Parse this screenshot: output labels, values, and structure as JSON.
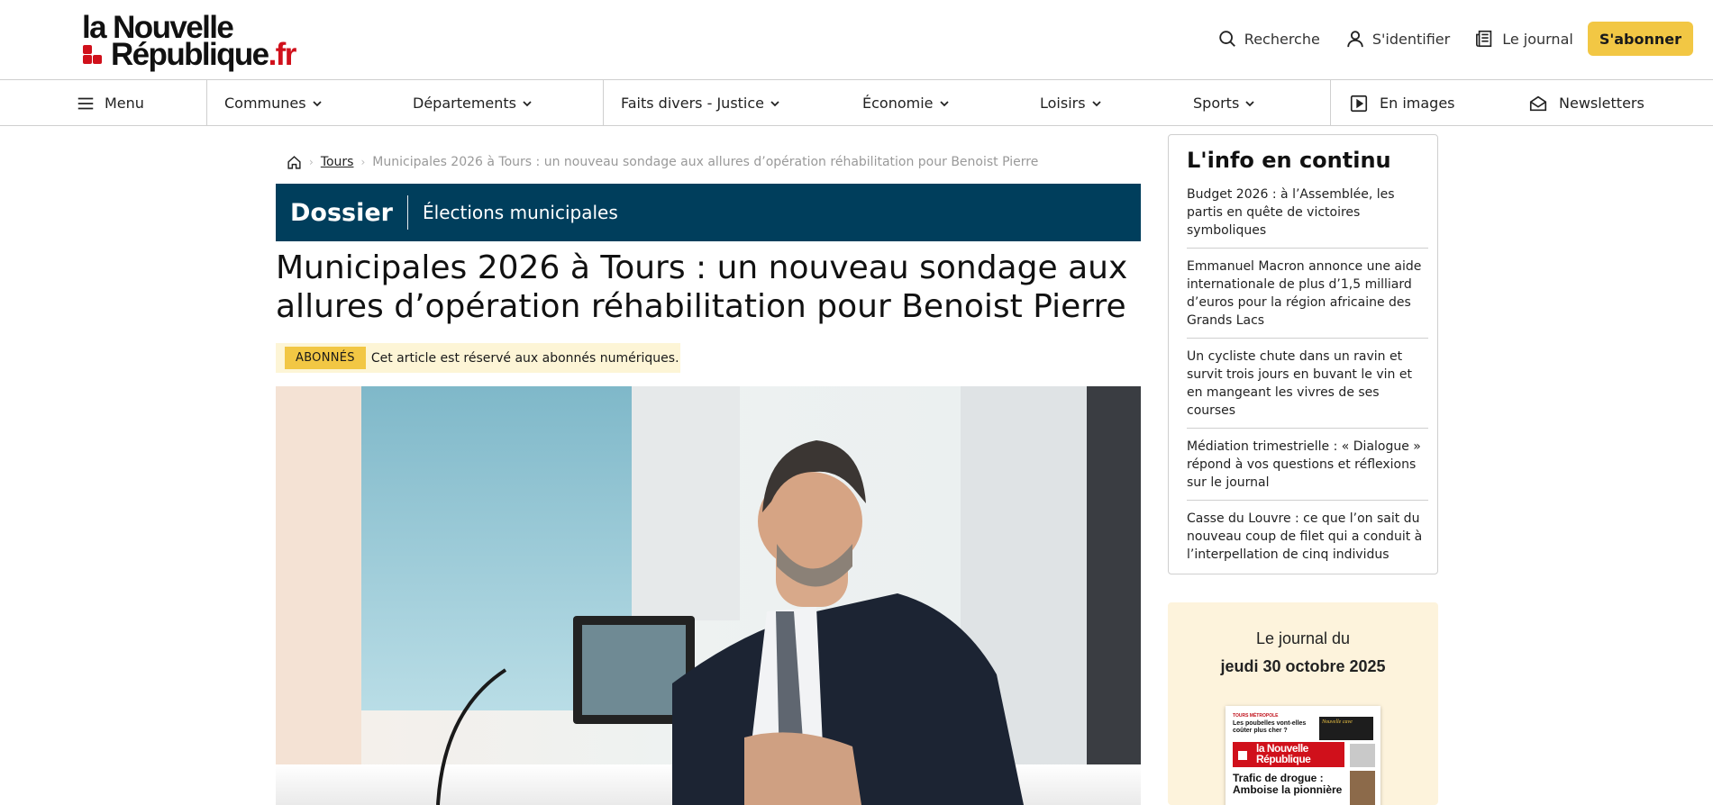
{
  "header": {
    "logo_line1": "la Nouvelle",
    "logo_line2": "République",
    "logo_tld": ".fr",
    "search_label": "Recherche",
    "login_label": "S'identifier",
    "journal_label": "Le journal",
    "subscribe_label": "S'abonner",
    "brand_red": "#d0101b",
    "accent_yellow": "#f2c744"
  },
  "nav": {
    "menu_label": "Menu",
    "items": [
      {
        "label": "Communes"
      },
      {
        "label": "Départements"
      },
      {
        "label": "Faits divers - Justice"
      },
      {
        "label": "Économie"
      },
      {
        "label": "Loisirs"
      },
      {
        "label": "Sports"
      }
    ],
    "images_label": "En images",
    "newsletters_label": "Newsletters"
  },
  "breadcrumb": {
    "home_icon": "home-icon",
    "city": "Tours",
    "current": "Municipales 2026 à Tours : un nouveau sondage aux allures d’opération réhabilitation pour Benoist Pierre"
  },
  "dossier": {
    "label": "Dossier",
    "topic": "Élections municipales",
    "band_color": "#003e5c"
  },
  "article": {
    "title": "Municipales 2026 à Tours : un nouveau sondage aux allures d’opération réhabilitation pour Benoist Pierre",
    "premium_badge": "ABONNÉS",
    "premium_text": "Cet article est réservé aux abonnés numériques."
  },
  "feed": {
    "title": "L'info en continu",
    "items": [
      {
        "text": "Budget 2026 : à l’Assemblée, les partis en quête de victoires symboliques"
      },
      {
        "text": "Emmanuel Macron annonce une aide internationale de plus d’1,5 milliard d’euros pour la région africaine des Grands Lacs"
      },
      {
        "text": "Un cycliste chute dans un ravin et survit trois jours en buvant le vin et en mangeant les vivres de ses courses"
      },
      {
        "text": "Médiation trimestrielle : « Dialogue » répond à vos questions et réflexions sur le journal"
      },
      {
        "text": "Casse du Louvre : ce que l’on sait du nouveau coup de filet qui a conduit à l’interpellation de cinq individus"
      }
    ]
  },
  "journal": {
    "line1": "Le journal du",
    "date": "jeudi 30 octobre 2025",
    "cover": {
      "kicker": "TOURS MÉTROPOLE",
      "question": "Les poubelles vont-elles coûter plus cher ?",
      "ad": "Nouvelle cave",
      "logo": "la Nouvelle République",
      "headline": "Trafic de drogue : Amboise la pionnière"
    }
  }
}
